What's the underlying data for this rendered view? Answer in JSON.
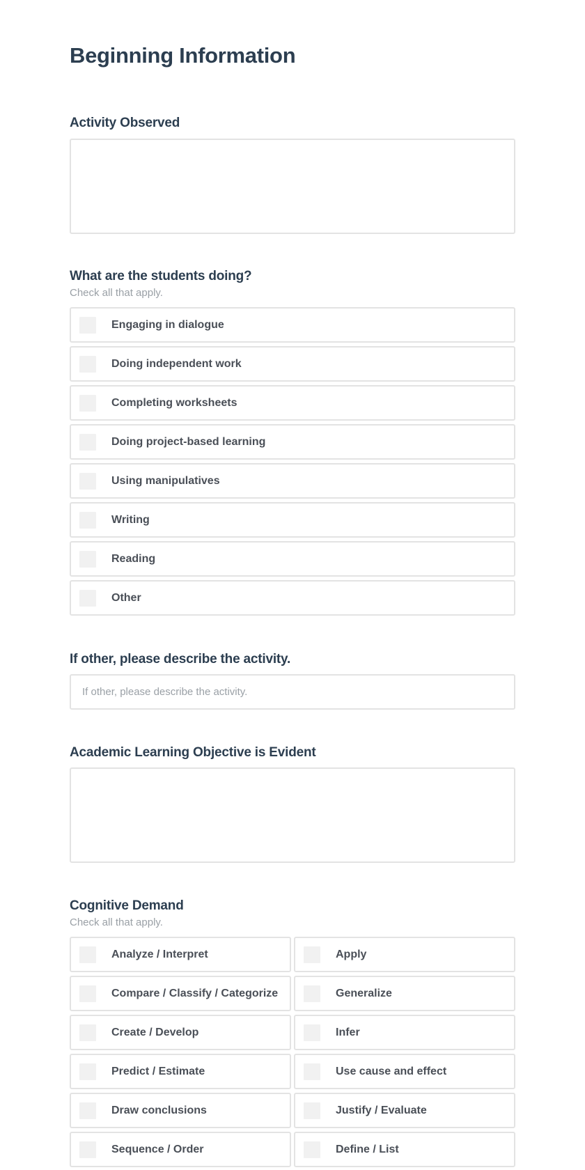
{
  "page": {
    "title": "Beginning Information"
  },
  "activity_observed": {
    "label": "Activity Observed",
    "value": ""
  },
  "students_doing": {
    "label": "What are the students doing?",
    "hint": "Check all that apply.",
    "options": [
      {
        "label": "Engaging in dialogue",
        "checked": false
      },
      {
        "label": "Doing independent work",
        "checked": false
      },
      {
        "label": "Completing worksheets",
        "checked": false
      },
      {
        "label": "Doing project-based learning",
        "checked": false
      },
      {
        "label": "Using manipulatives",
        "checked": false
      },
      {
        "label": "Writing",
        "checked": false
      },
      {
        "label": "Reading",
        "checked": false
      },
      {
        "label": "Other",
        "checked": false
      }
    ]
  },
  "other_activity": {
    "label": "If other, please describe the activity.",
    "placeholder": "If other, please describe the activity.",
    "value": ""
  },
  "learning_objective": {
    "label": "Academic Learning Objective is Evident",
    "value": ""
  },
  "cognitive_demand": {
    "label": "Cognitive Demand",
    "hint": "Check all that apply.",
    "options": [
      {
        "label": "Analyze / Interpret",
        "checked": false
      },
      {
        "label": "Apply",
        "checked": false
      },
      {
        "label": "Compare / Classify / Categorize",
        "checked": false
      },
      {
        "label": "Generalize",
        "checked": false
      },
      {
        "label": "Create / Develop",
        "checked": false
      },
      {
        "label": "Infer",
        "checked": false
      },
      {
        "label": "Predict / Estimate",
        "checked": false
      },
      {
        "label": "Use cause and effect",
        "checked": false
      },
      {
        "label": "Draw conclusions",
        "checked": false
      },
      {
        "label": "Justify / Evaluate",
        "checked": false
      },
      {
        "label": "Sequence / Order",
        "checked": false
      },
      {
        "label": "Define / List",
        "checked": false
      }
    ]
  }
}
